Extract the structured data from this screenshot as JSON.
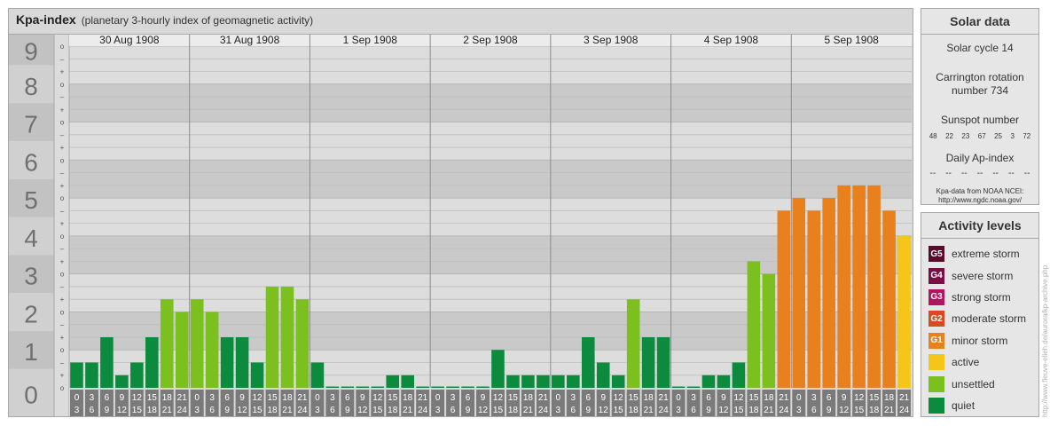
{
  "title": {
    "main": "Kpa-index",
    "sub": "(planetary 3-hourly index of geomagnetic activity)"
  },
  "y_axis": {
    "labels": [
      "0",
      "1",
      "2",
      "3",
      "4",
      "5",
      "6",
      "7",
      "8",
      "9"
    ],
    "sub_markers": [
      "o",
      "+",
      "–",
      "o"
    ]
  },
  "x_axis": {
    "days": [
      "30 Aug 1908",
      "31 Aug 1908",
      "1 Sep 1908",
      "2 Sep 1908",
      "3 Sep 1908",
      "4 Sep 1908",
      "5 Sep 1908"
    ],
    "interval_top": [
      "0",
      "3",
      "6",
      "9",
      "12",
      "15",
      "18",
      "21"
    ],
    "interval_bottom": [
      "3",
      "6",
      "9",
      "12",
      "15",
      "18",
      "21",
      "24"
    ]
  },
  "chart_data": {
    "type": "bar",
    "title": "Kpa-index",
    "subtitle": "(planetary 3-hourly index of geomagnetic activity)",
    "ylim": [
      0,
      9
    ],
    "days": [
      "30 Aug 1908",
      "31 Aug 1908",
      "1 Sep 1908",
      "2 Sep 1908",
      "3 Sep 1908",
      "4 Sep 1908",
      "5 Sep 1908"
    ],
    "values": [
      0.667,
      0.667,
      1.333,
      0.333,
      0.667,
      1.333,
      2.333,
      2.0,
      2.333,
      2.0,
      1.333,
      1.333,
      0.667,
      2.667,
      2.667,
      2.333,
      0.667,
      0.0,
      0.0,
      0.0,
      0.0,
      0.333,
      0.333,
      0.0,
      0.0,
      0.0,
      0.0,
      0.0,
      1.0,
      0.333,
      0.333,
      0.333,
      0.333,
      0.333,
      1.333,
      0.667,
      0.333,
      2.333,
      1.333,
      1.333,
      0.0,
      0.0,
      0.333,
      0.333,
      0.667,
      3.333,
      3.0,
      4.667,
      5.0,
      4.667,
      5.0,
      5.333,
      5.333,
      5.333,
      4.667,
      4.0
    ],
    "levels": [
      {
        "name": "extreme storm",
        "code": "G5",
        "min": 9
      },
      {
        "name": "severe storm",
        "code": "G4",
        "min": 8
      },
      {
        "name": "strong storm",
        "code": "G3",
        "min": 7
      },
      {
        "name": "moderate storm",
        "code": "G2",
        "min": 6
      },
      {
        "name": "minor storm",
        "code": "G1",
        "min": 4.667
      },
      {
        "name": "active",
        "code": "",
        "min": 4
      },
      {
        "name": "unsettled",
        "code": "",
        "min": 2
      },
      {
        "name": "quiet",
        "code": "",
        "min": 0
      }
    ]
  },
  "colors": {
    "extreme": "#5a0a2a",
    "severe": "#7a0d45",
    "strong": "#b01560",
    "moderate": "#d84a20",
    "minor": "#e8801e",
    "active": "#f5c518",
    "unsettled": "#7cc020",
    "quiet": "#0c8a3e"
  },
  "solar": {
    "header": "Solar data",
    "cycle": "Solar cycle 14",
    "carrington_1": "Carrington rotation",
    "carrington_2": "number 734",
    "sunspot_label": "Sunspot number",
    "sunspots": [
      "48",
      "22",
      "23",
      "67",
      "25",
      "3",
      "72"
    ],
    "ap_label": "Daily Ap-index",
    "ap_values": [
      "--",
      "--",
      "--",
      "--",
      "--",
      "--",
      "--"
    ],
    "source_1": "Kpa-data from NOAA NCEI:",
    "source_2": "http://www.ngdc.noaa.gov/"
  },
  "activity": {
    "header": "Activity levels",
    "items": [
      {
        "code": "G5",
        "label": "extreme storm",
        "color": "#5a0a2a"
      },
      {
        "code": "G4",
        "label": "severe storm",
        "color": "#7a0d45"
      },
      {
        "code": "G3",
        "label": "strong storm",
        "color": "#b01560"
      },
      {
        "code": "G2",
        "label": "moderate storm",
        "color": "#d84a20"
      },
      {
        "code": "G1",
        "label": "minor storm",
        "color": "#e8801e"
      },
      {
        "code": "",
        "label": "active",
        "color": "#f5c518"
      },
      {
        "code": "",
        "label": "unsettled",
        "color": "#7cc020"
      },
      {
        "code": "",
        "label": "quiet",
        "color": "#0c8a3e"
      }
    ]
  },
  "credit": "http://www.fleuve-elieh.de/aurora/kp-archive.php"
}
